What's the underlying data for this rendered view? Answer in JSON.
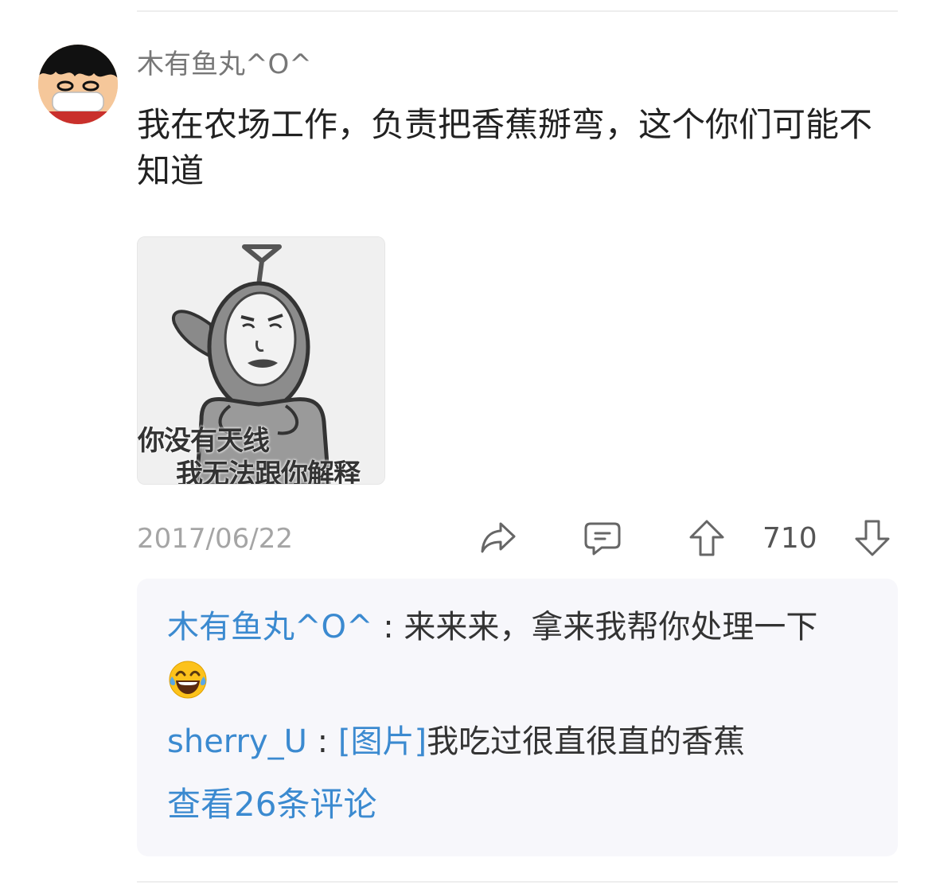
{
  "post": {
    "username": "木有鱼丸^O^",
    "text": "我在农场工作，负责把香蕉掰弯，这个你们可能不知道",
    "image": {
      "caption_line1": "你没有天线",
      "caption_line2": "我无法跟你解释"
    },
    "date": "2017/06/22",
    "like_count": "710",
    "icons": [
      "share-icon",
      "comment-icon",
      "upvote-icon",
      "downvote-icon"
    ]
  },
  "comments": {
    "items": [
      {
        "author": "木有鱼丸^O^",
        "separator": " : ",
        "text": "来来来，拿来我帮你处理一下",
        "emoji": "laughing-tears-emoji"
      },
      {
        "author": "sherry_U",
        "separator": " : ",
        "link": "[图片]",
        "text": "我吃过很直很直的香蕉"
      }
    ],
    "view_all": "查看26条评论"
  },
  "colors": {
    "link_blue": "#3b8ad0",
    "meta_gray": "#a5a5a5",
    "comment_bg": "#f7f7fb"
  }
}
